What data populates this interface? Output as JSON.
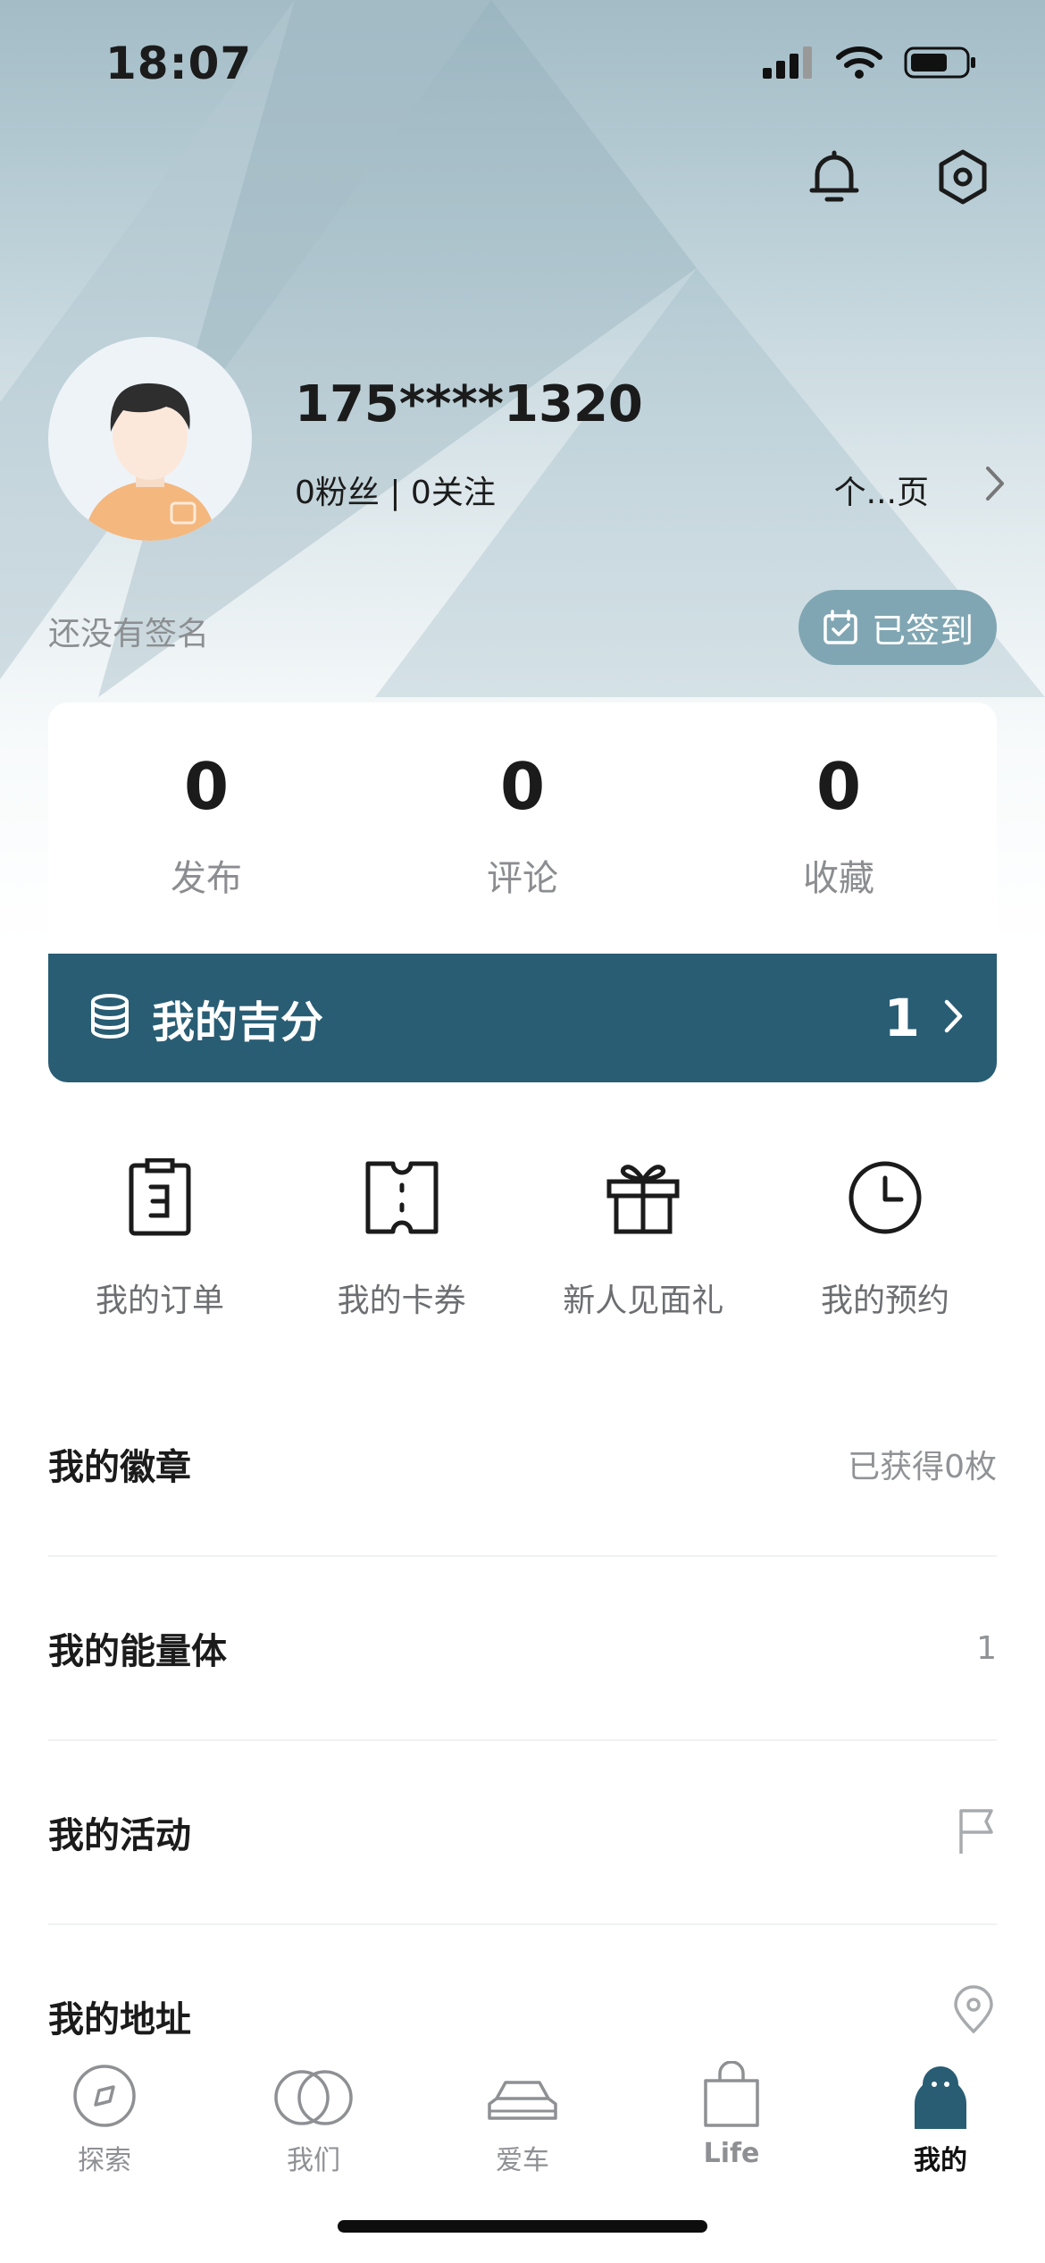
{
  "status_bar": {
    "time": "18:07"
  },
  "profile": {
    "username": "175****1320",
    "fans_label": "0粉丝 | 0关注",
    "homepage_label": "个...页",
    "signature": "还没有签名",
    "signin_label": "已签到"
  },
  "stats": [
    {
      "value": "0",
      "label": "发布"
    },
    {
      "value": "0",
      "label": "评论"
    },
    {
      "value": "0",
      "label": "收藏"
    }
  ],
  "points": {
    "title": "我的吉分",
    "value": "1"
  },
  "shortcuts": [
    {
      "label": "我的订单",
      "icon": "order-icon"
    },
    {
      "label": "我的卡券",
      "icon": "coupon-icon"
    },
    {
      "label": "新人见面礼",
      "icon": "gift-icon"
    },
    {
      "label": "我的预约",
      "icon": "clock-icon"
    }
  ],
  "list": [
    {
      "label": "我的徽章",
      "value": "已获得0枚"
    },
    {
      "label": "我的能量体",
      "value": "1"
    },
    {
      "label": "我的活动",
      "icon": "flag-icon"
    },
    {
      "label": "我的地址",
      "icon": "location-icon"
    }
  ],
  "tabbar": [
    {
      "label": "探索",
      "icon": "compass-icon"
    },
    {
      "label": "我们",
      "icon": "rings-icon"
    },
    {
      "label": "爱车",
      "icon": "car-icon"
    },
    {
      "label": "Life",
      "icon": "bag-icon"
    },
    {
      "label": "我的",
      "icon": "person-icon",
      "active": true
    }
  ],
  "colors": {
    "accent": "#285d74",
    "signin_bg": "#80a6b3"
  }
}
